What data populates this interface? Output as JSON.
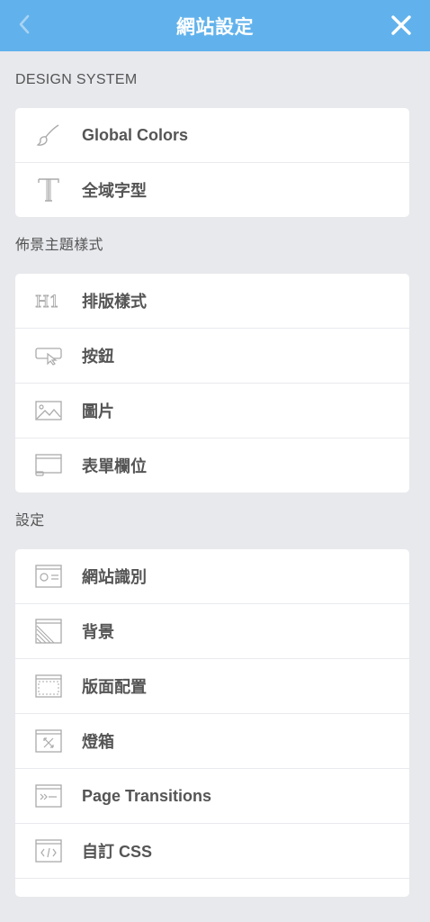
{
  "header": {
    "title": "網站設定",
    "back_icon": "chevron-left-icon",
    "close_icon": "close-icon",
    "bg_color": "#61b2ec"
  },
  "sections": [
    {
      "label": "DESIGN SYSTEM",
      "items": [
        {
          "label": "Global Colors",
          "icon": "brush-icon"
        },
        {
          "label": "全域字型",
          "icon": "typography-icon"
        }
      ]
    },
    {
      "label": "佈景主題樣式",
      "items": [
        {
          "label": "排版樣式",
          "icon": "heading-icon"
        },
        {
          "label": "按鈕",
          "icon": "button-icon"
        },
        {
          "label": "圖片",
          "icon": "image-icon"
        },
        {
          "label": "表單欄位",
          "icon": "form-field-icon"
        }
      ]
    },
    {
      "label": "設定",
      "items": [
        {
          "label": "網站識別",
          "icon": "site-identity-icon"
        },
        {
          "label": "背景",
          "icon": "background-icon"
        },
        {
          "label": "版面配置",
          "icon": "layout-icon"
        },
        {
          "label": "燈箱",
          "icon": "lightbox-icon"
        },
        {
          "label": "Page Transitions",
          "icon": "page-transitions-icon"
        },
        {
          "label": "自訂 CSS",
          "icon": "custom-css-icon"
        }
      ]
    }
  ]
}
